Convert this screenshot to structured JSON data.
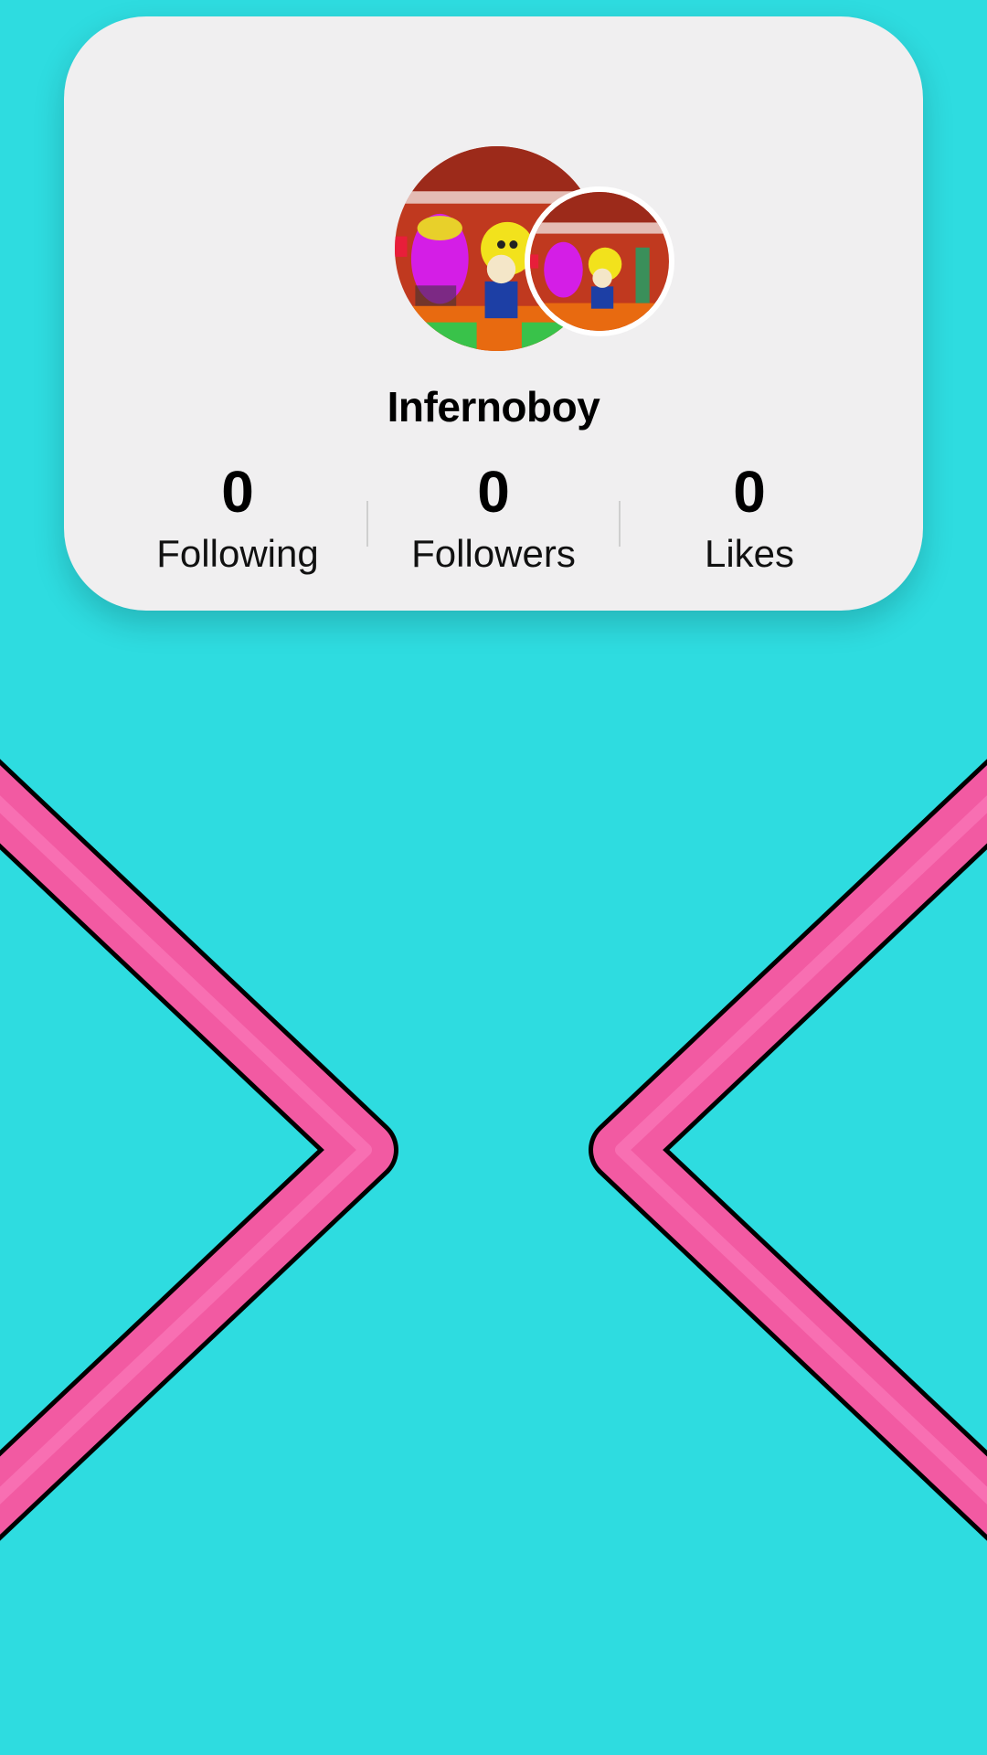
{
  "profile": {
    "username": "Infernoboy",
    "avatar_primary": "profile-avatar",
    "avatar_secondary": "profile-avatar-secondary"
  },
  "stats": [
    {
      "value": "0",
      "label": "Following"
    },
    {
      "value": "0",
      "label": "Followers"
    },
    {
      "value": "0",
      "label": "Likes"
    }
  ],
  "theme": {
    "background": "#2edce0",
    "card": "#f0eff0",
    "chevron": "#f25aa2",
    "chevron_outline": "#000000"
  },
  "decorations": {
    "left_icon": "chevron-right-icon",
    "right_icon": "chevron-left-icon"
  }
}
